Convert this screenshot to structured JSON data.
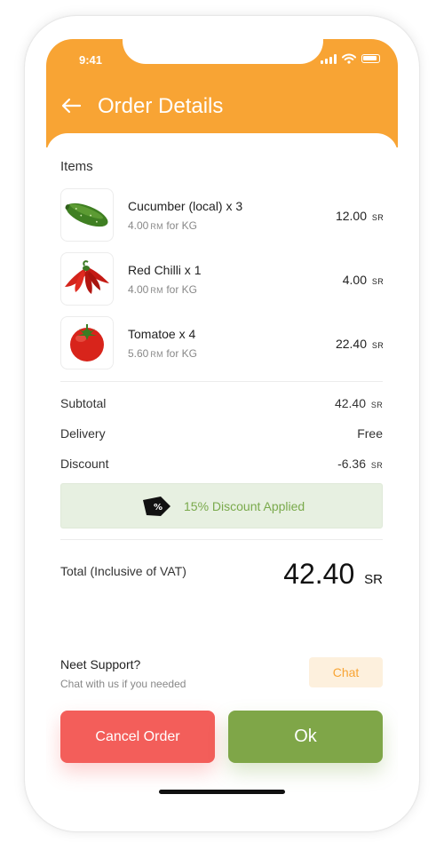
{
  "status_bar": {
    "time": "9:41"
  },
  "header": {
    "title": "Order Details"
  },
  "items_label": "Items",
  "items": [
    {
      "name": "Cucumber (local) x 3",
      "unit_price": "4.00",
      "unit_price_currency": "RM",
      "unit_suffix": "for KG",
      "price": "12.00",
      "currency": "SR",
      "icon": "cucumber-icon"
    },
    {
      "name": "Red Chilli x 1",
      "unit_price": "4.00",
      "unit_price_currency": "RM",
      "unit_suffix": "for KG",
      "price": "4.00",
      "currency": "SR",
      "icon": "chilli-icon"
    },
    {
      "name": "Tomatoe x 4",
      "unit_price": "5.60",
      "unit_price_currency": "RM",
      "unit_suffix": "for KG",
      "price": "22.40",
      "currency": "SR",
      "icon": "tomato-icon"
    }
  ],
  "summary": {
    "subtotal_label": "Subtotal",
    "subtotal_value": "42.40",
    "subtotal_currency": "SR",
    "delivery_label": "Delivery",
    "delivery_value": "Free",
    "discount_label": "Discount",
    "discount_value": "-6.36",
    "discount_currency": "SR"
  },
  "discount_banner": {
    "text": "15% Discount Applied",
    "icon": "discount-tag-icon"
  },
  "total": {
    "label": "Total (Inclusive of VAT)",
    "value": "42.40",
    "currency": "SR"
  },
  "support": {
    "title": "Neet Support?",
    "subtitle": "Chat with us if you needed",
    "chat_label": "Chat"
  },
  "actions": {
    "cancel_label": "Cancel Order",
    "ok_label": "Ok"
  },
  "colors": {
    "accent": "#f8a434",
    "cancel": "#f35e5a",
    "ok": "#7fa648",
    "discount_bg": "#e7f0e1",
    "discount_text": "#7aaa4c"
  }
}
